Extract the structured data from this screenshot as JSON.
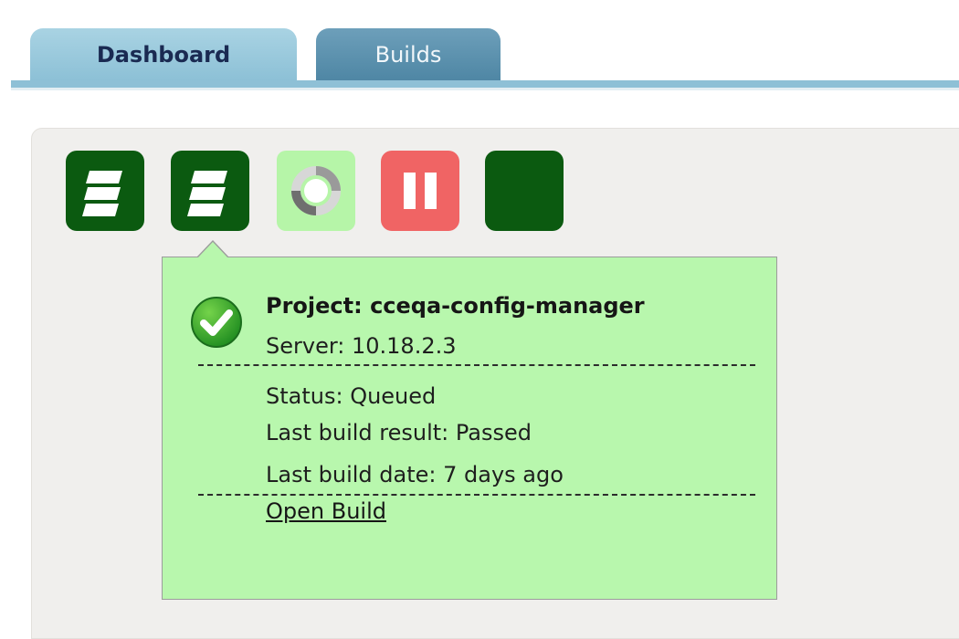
{
  "tabs": [
    {
      "label": "Dashboard",
      "active": true
    },
    {
      "label": "Builds",
      "active": false
    }
  ],
  "project_icons": [
    {
      "state": "building",
      "icon": "stacked-layers-icon",
      "color": "#0b5a10"
    },
    {
      "state": "building",
      "icon": "stacked-layers-icon",
      "color": "#0b5a10"
    },
    {
      "state": "pending",
      "icon": "spinner-icon",
      "color": "#b6f5a8"
    },
    {
      "state": "paused",
      "icon": "pause-icon",
      "color": "#f06464"
    },
    {
      "state": "passed",
      "icon": null,
      "color": "#0b5a10"
    }
  ],
  "popup": {
    "status_icon": "check-circle-icon",
    "project": "Project: cceqa-config-manager",
    "server": "Server: 10.18.2.3",
    "status": "Status: Queued",
    "last_build_result": "Last build result: Passed",
    "last_build_date": "Last build date: 7 days ago",
    "open_build_link": "Open Build",
    "background_color": "#b8f7ad"
  }
}
